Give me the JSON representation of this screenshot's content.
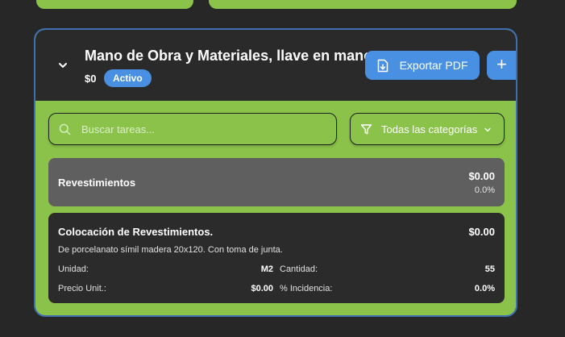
{
  "section": {
    "title": "Mano de Obra y Materiales, llave en mano.",
    "amount": "$0",
    "status_badge": "Activo",
    "export_label": "Exportar PDF",
    "add_label": "+"
  },
  "search": {
    "placeholder": "Buscar tareas...",
    "value": ""
  },
  "filter": {
    "selected": "Todas las categorías"
  },
  "category": {
    "name": "Revestimientos",
    "total": "$0.00",
    "percent": "0.0%"
  },
  "task": {
    "name": "Colocación de Revestimientos.",
    "total": "$0.00",
    "description": "De porcelanato símil madera 20x120. Con toma de junta.",
    "unit_label": "Unidad:",
    "unit_value": "M2",
    "quantity_label": "Cantidad:",
    "quantity_value": "55",
    "price_label": "Precio Unit.:",
    "price_value": "$0.00",
    "incidence_label": "% Incidencia:",
    "incidence_value": "0.0%"
  },
  "colors": {
    "accent": "#4a90e2",
    "panel_green": "#8bc34a",
    "background": "#272727",
    "category_gray": "#5f5f5f",
    "task_dark": "#2b2b2b"
  }
}
